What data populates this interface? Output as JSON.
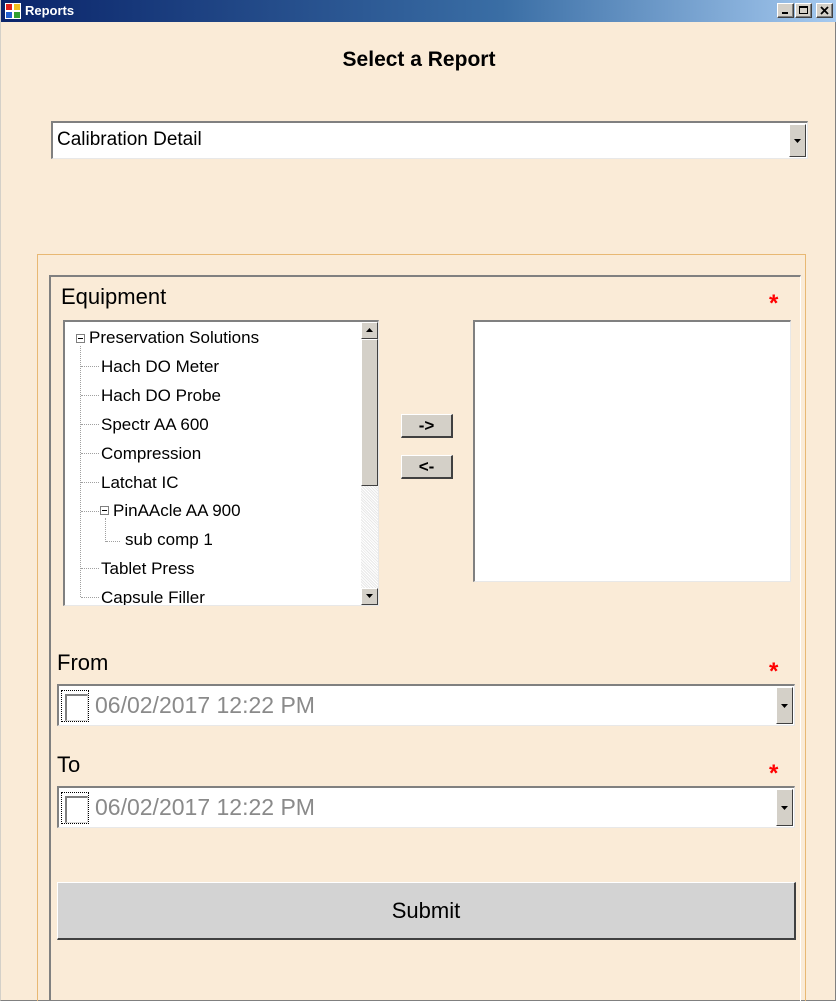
{
  "window": {
    "title": "Reports",
    "controls": [
      "minimize",
      "maximize",
      "close"
    ]
  },
  "heading": "Select a Report",
  "report_select": {
    "selected": "Calibration Detail"
  },
  "equipment": {
    "label": "Equipment",
    "required_marker": "*",
    "tree": [
      {
        "label": "Preservation Solutions",
        "level": 0,
        "expanded": true
      },
      {
        "label": "Hach DO Meter",
        "level": 1
      },
      {
        "label": "Hach DO Probe",
        "level": 1
      },
      {
        "label": "Spectr AA 600",
        "level": 1
      },
      {
        "label": "Compression",
        "level": 1
      },
      {
        "label": "Latchat IC",
        "level": 1
      },
      {
        "label": "PinAAcle AA 900",
        "level": 1,
        "expanded": true
      },
      {
        "label": "sub comp 1",
        "level": 2
      },
      {
        "label": "Tablet Press",
        "level": 1
      },
      {
        "label": "Capsule Filler",
        "level": 1
      }
    ],
    "add_button": "->",
    "remove_button": "<-",
    "selected_items": []
  },
  "from": {
    "label": "From",
    "required_marker": "*",
    "value": "06/02/2017 12:22 PM",
    "checked": false
  },
  "to": {
    "label": "To",
    "required_marker": "*",
    "value": "06/02/2017 12:22 PM",
    "checked": false
  },
  "submit_label": "Submit",
  "colors": {
    "background": "#faebd7",
    "required": "#ff0000",
    "titlebar": "#0a246a",
    "disabled_text": "#8a8a8a"
  }
}
